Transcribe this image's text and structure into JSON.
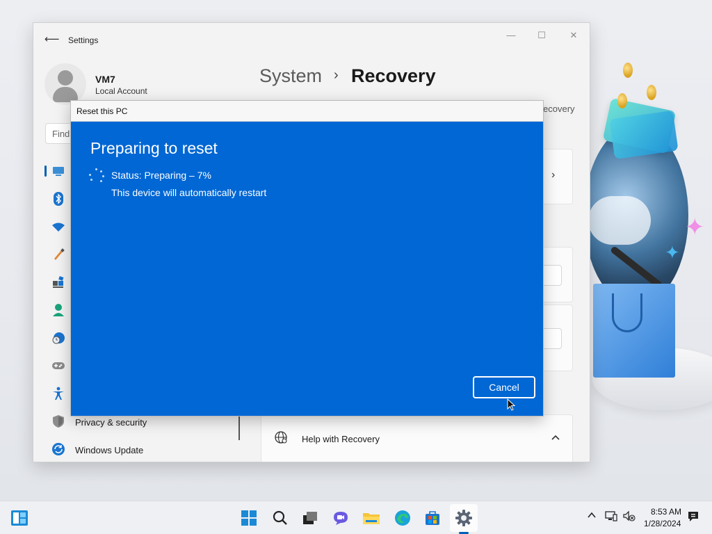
{
  "settings": {
    "window_title": "Settings",
    "back_icon": "back-arrow-icon",
    "window_controls": {
      "minimize": "—",
      "maximize": "☐",
      "close": "✕"
    },
    "user": {
      "name": "VM7",
      "account_type": "Local Account"
    },
    "search": {
      "placeholder": "Find"
    },
    "breadcrumb": {
      "section": "System",
      "separator": "›",
      "current": "Recovery"
    },
    "peek_text": "ecovery",
    "sidebar": {
      "icons": [
        "display-icon",
        "bluetooth-icon",
        "wifi-icon",
        "brush-icon",
        "apps-icon",
        "accounts-icon",
        "time-language-icon",
        "gaming-icon",
        "accessibility-icon",
        "shield-icon",
        "windows-update-icon"
      ],
      "items": [
        {
          "label": "Privacy & security"
        },
        {
          "label": "Windows Update"
        }
      ]
    },
    "help_card": {
      "label": "Help with Recovery"
    }
  },
  "dialog": {
    "title": "Reset this PC",
    "heading": "Preparing to reset",
    "status": "Status: Preparing – 7%",
    "note": "This device will automatically restart",
    "cancel_label": "Cancel",
    "progress_percent": 7
  },
  "taskbar": {
    "icons": [
      "widgets-icon",
      "start-icon",
      "search-icon",
      "task-view-icon",
      "chat-icon",
      "file-explorer-icon",
      "edge-icon",
      "store-icon",
      "settings-icon"
    ],
    "active": "settings-icon",
    "tray": {
      "chevron": "^",
      "time": "8:53 AM",
      "date": "1/28/2024"
    }
  },
  "colors": {
    "dialog_blue": "#0067d4",
    "accent": "#005fb8",
    "settings_bg": "#f3f3f3"
  }
}
